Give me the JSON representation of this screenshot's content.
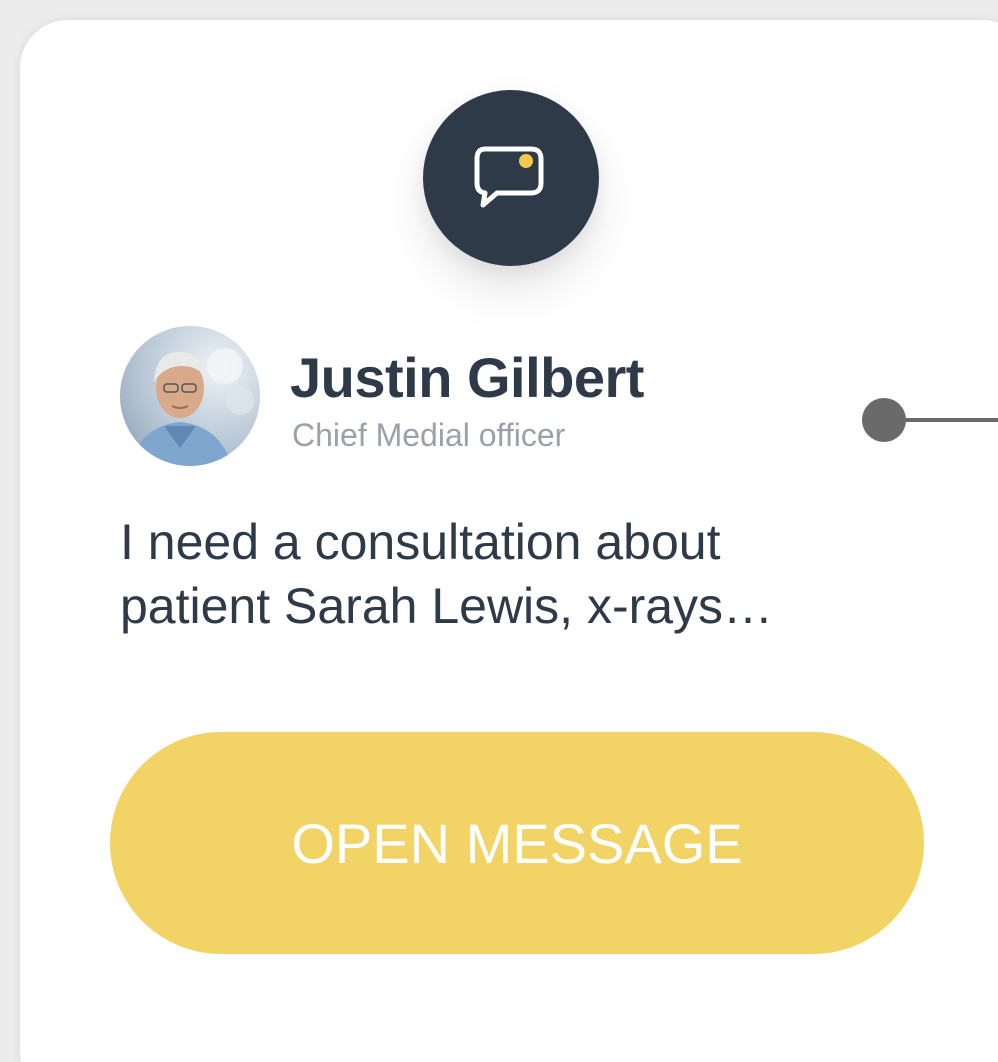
{
  "notification": {
    "icon": "chat-bubble-icon",
    "unread_indicator_color": "#f2c94c",
    "sender": {
      "name": "Justin Gilbert",
      "role": "Chief Medial officer",
      "avatar": "avatar-photo"
    },
    "message_preview": {
      "line1": "I need a consultation about",
      "line2": "patient Sarah Lewis, x-rays…"
    },
    "action": {
      "label": "OPEN MESSAGE"
    }
  },
  "colors": {
    "badge_background": "#2e3a48",
    "button_background": "#f2d366",
    "button_text": "#ffffff",
    "name_text": "#2e3a48",
    "role_text": "#9aa1a9",
    "connector": "#6a6a6a"
  }
}
